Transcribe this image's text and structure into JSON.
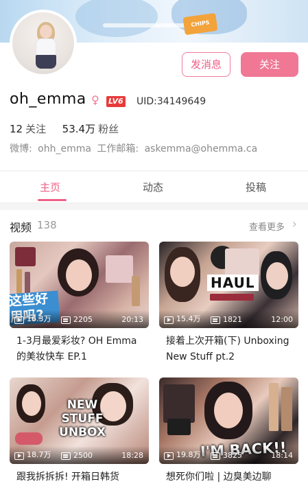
{
  "profile": {
    "name": "oh_emma",
    "level": "LV6",
    "uid": "UID:34149649",
    "following_count": "12",
    "following_label": "关注",
    "followers_count": "53.4万",
    "followers_label": "粉丝",
    "bio_weibo_label": "微博:",
    "bio_weibo_value": "ohh_emma",
    "bio_email_label": "工作邮箱:",
    "bio_email_value": "askemma@ohemma.ca"
  },
  "actions": {
    "message_label": "发消息",
    "follow_label": "关注"
  },
  "banner": {
    "snack_text": "CHIPS"
  },
  "tabs": [
    {
      "label": "主页",
      "active": true
    },
    {
      "label": "动态",
      "active": false
    },
    {
      "label": "投稿",
      "active": false
    }
  ],
  "videos_section": {
    "title": "视频",
    "count": "138",
    "more_label": "查看更多"
  },
  "videos": [
    {
      "views": "16.3万",
      "danmaku": "2205",
      "duration": "20:13",
      "title": "1-3月最爱彩妆? OH Emma的美妆快车 EP.1",
      "overlay_text": "这些好用吗?"
    },
    {
      "views": "15.4万",
      "danmaku": "1821",
      "duration": "12:00",
      "title": "接着上次开箱(下) Unboxing New Stuff pt.2",
      "overlay_text": "HAUL"
    },
    {
      "views": "18.7万",
      "danmaku": "2500",
      "duration": "18:28",
      "title": "跟我拆拆拆! 开箱日韩货",
      "overlay_text": "NEW STUFF UNBOX"
    },
    {
      "views": "19.8万",
      "danmaku": "3825",
      "duration": "18:14",
      "title": "想死你们啦 | 边臭美边聊",
      "overlay_text": "I'M BACK!!"
    }
  ],
  "colors": {
    "accent": "#ef5f86",
    "follow_bg": "#f07895",
    "level_badge": "#e83a3a"
  }
}
